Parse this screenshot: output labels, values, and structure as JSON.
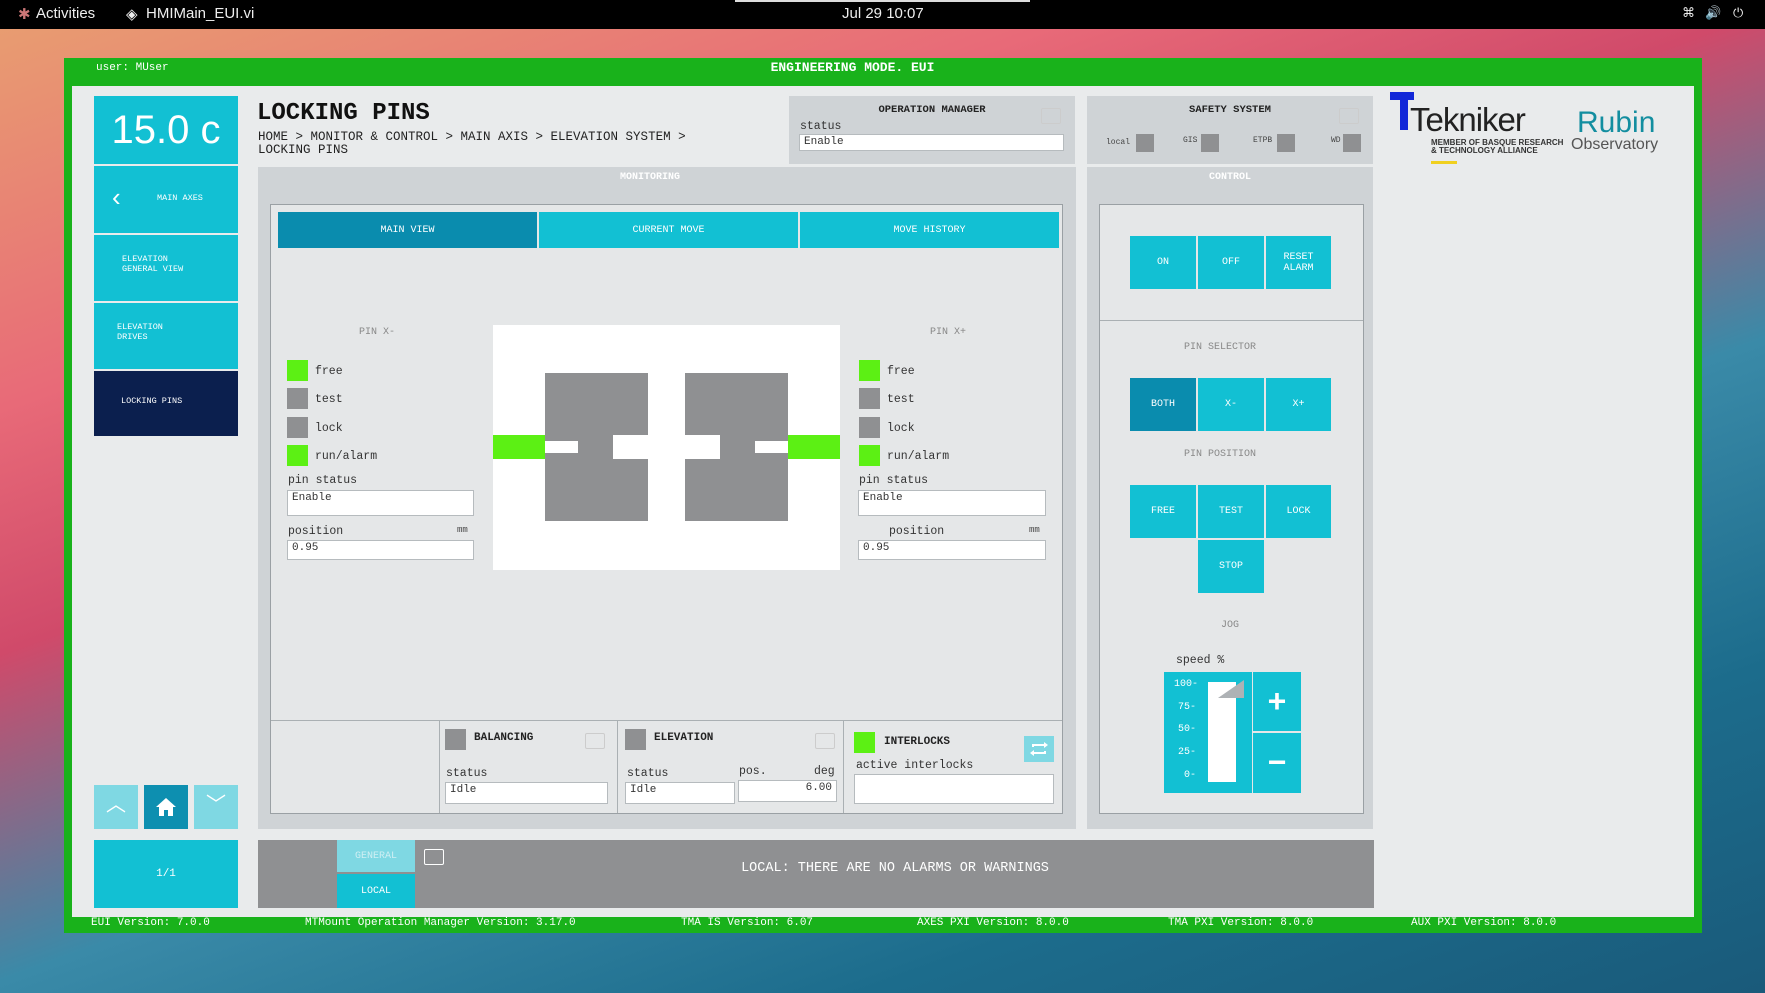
{
  "os": {
    "activities": "Activities",
    "app_name": "HMIMain_EUI.vi",
    "clock": "Jul 29  10:07"
  },
  "header": {
    "user": "user: MUser",
    "mode": "ENGINEERING MODE. EUI"
  },
  "temperature": "15.0 c",
  "nav": {
    "back_label": "MAIN AXES",
    "items": [
      "ELEVATION\nGENERAL VIEW",
      "ELEVATION\nDRIVES",
      "LOCKING PINS"
    ],
    "page": "1/1"
  },
  "page": {
    "title": "LOCKING PINS",
    "breadcrumb": "HOME > MONITOR & CONTROL > MAIN AXIS > ELEVATION SYSTEM >\nLOCKING PINS"
  },
  "operation_manager": {
    "title": "OPERATION MANAGER",
    "status_label": "status",
    "status_value": "Enable"
  },
  "safety_system": {
    "title": "SAFETY SYSTEM",
    "items": [
      "local",
      "GIS",
      "ETPB",
      "WD"
    ]
  },
  "logos": {
    "tekniker": "Tekniker",
    "tekniker_sub": "MEMBER OF BASQUE RESEARCH\n& TECHNOLOGY ALLIANCE",
    "rubin": "Rubin",
    "rubin_sub": "Observatory"
  },
  "monitoring": {
    "title": "MONITORING",
    "tabs": [
      "MAIN VIEW",
      "CURRENT MOVE",
      "MOVE HISTORY"
    ],
    "pin_minus": {
      "title": "PIN X-",
      "states": [
        {
          "label": "free",
          "on": true
        },
        {
          "label": "test",
          "on": false
        },
        {
          "label": "lock",
          "on": false
        },
        {
          "label": "run/alarm",
          "on": true
        }
      ],
      "pin_status_label": "pin status",
      "pin_status": "Enable",
      "position_label": "position",
      "position_unit": "mm",
      "position": "0.95"
    },
    "pin_plus": {
      "title": "PIN X+",
      "states": [
        {
          "label": "free",
          "on": true
        },
        {
          "label": "test",
          "on": false
        },
        {
          "label": "lock",
          "on": false
        },
        {
          "label": "run/alarm",
          "on": true
        }
      ],
      "pin_status_label": "pin status",
      "pin_status": "Enable",
      "position_label": "position",
      "position_unit": "mm",
      "position": "0.95"
    },
    "balancing": {
      "title": "BALANCING",
      "status_label": "status",
      "status": "Idle"
    },
    "elevation": {
      "title": "ELEVATION",
      "status_label": "status",
      "status": "Idle",
      "pos_label": "pos.",
      "pos_unit": "deg",
      "pos": "6.00"
    },
    "interlocks": {
      "title": "INTERLOCKS",
      "active_label": "active interlocks",
      "active": ""
    }
  },
  "control": {
    "title": "CONTROL",
    "power": [
      "ON",
      "OFF",
      "RESET\nALARM"
    ],
    "pin_selector_title": "PIN SELECTOR",
    "pin_selector": [
      "BOTH",
      "X-",
      "X+"
    ],
    "pin_position_title": "PIN POSITION",
    "pin_position": [
      "FREE",
      "TEST",
      "LOCK"
    ],
    "stop": "STOP",
    "jog_title": "JOG",
    "speed_label": "speed %",
    "speed_ticks": [
      "100-",
      "75-",
      "50-",
      "25-",
      "0-"
    ],
    "speed_value": 100,
    "plus": "+",
    "minus": "−"
  },
  "alarms": {
    "tabs": [
      "GENERAL",
      "LOCAL"
    ],
    "message": "LOCAL: THERE ARE NO ALARMS OR WARNINGS"
  },
  "footer": {
    "versions": [
      "EUI Version: 7.0.0",
      "MTMount Operation Manager Version: 3.17.0",
      "TMA IS Version: 6.07",
      "AXES PXI Version: 8.0.0",
      "TMA PXI Version: 8.0.0",
      "AUX PXI Version: 8.0.0"
    ]
  },
  "colors": {
    "frame_green": "#19b21b",
    "accent_cyan": "#12c0d3",
    "selected_blue": "#0a8cae",
    "led_on": "#5cf014",
    "led_off": "#8f9092",
    "nav_active": "#0b1f4e"
  }
}
